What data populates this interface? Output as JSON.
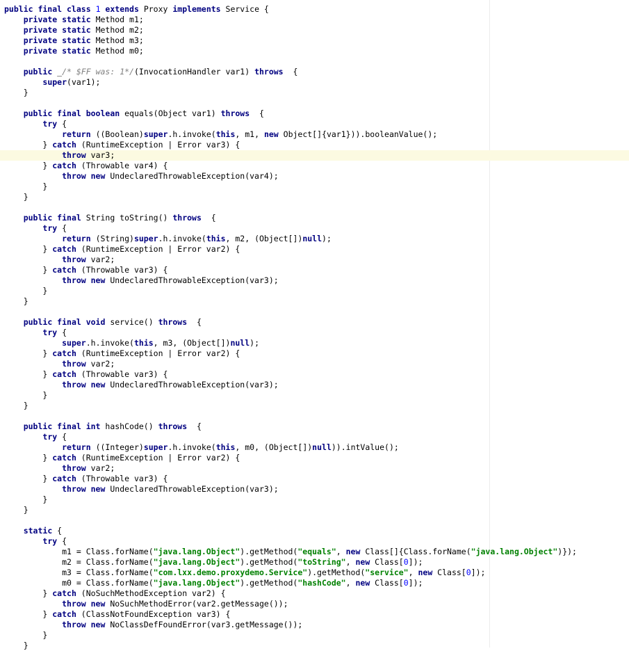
{
  "editor": {
    "highlighted_line": 14,
    "lines": [
      [
        [
          "kw",
          "public final class "
        ],
        [
          "num",
          "1"
        ],
        [
          "kw",
          " extends "
        ],
        [
          "plain",
          "Proxy "
        ],
        [
          "kw",
          "implements "
        ],
        [
          "plain",
          "Service {"
        ]
      ],
      [
        [
          "plain",
          "    "
        ],
        [
          "kw",
          "private static "
        ],
        [
          "plain",
          "Method m1;"
        ]
      ],
      [
        [
          "plain",
          "    "
        ],
        [
          "kw",
          "private static "
        ],
        [
          "plain",
          "Method m2;"
        ]
      ],
      [
        [
          "plain",
          "    "
        ],
        [
          "kw",
          "private static "
        ],
        [
          "plain",
          "Method m3;"
        ]
      ],
      [
        [
          "plain",
          "    "
        ],
        [
          "kw",
          "private static "
        ],
        [
          "plain",
          "Method m0;"
        ]
      ],
      [],
      [
        [
          "plain",
          "    "
        ],
        [
          "kw",
          "public "
        ],
        [
          "plain",
          "_"
        ],
        [
          "cmt",
          "/* $FF was: 1*/"
        ],
        [
          "plain",
          "(InvocationHandler var1) "
        ],
        [
          "kw",
          "throws"
        ],
        [
          "plain",
          "  {"
        ]
      ],
      [
        [
          "plain",
          "        "
        ],
        [
          "kw",
          "super"
        ],
        [
          "plain",
          "(var1);"
        ]
      ],
      [
        [
          "plain",
          "    }"
        ]
      ],
      [],
      [
        [
          "plain",
          "    "
        ],
        [
          "kw",
          "public final boolean "
        ],
        [
          "plain",
          "equals(Object var1) "
        ],
        [
          "kw",
          "throws"
        ],
        [
          "plain",
          "  {"
        ]
      ],
      [
        [
          "plain",
          "        "
        ],
        [
          "kw",
          "try "
        ],
        [
          "plain",
          "{"
        ]
      ],
      [
        [
          "plain",
          "            "
        ],
        [
          "kw",
          "return "
        ],
        [
          "plain",
          "((Boolean)"
        ],
        [
          "kw",
          "super"
        ],
        [
          "plain",
          ".h.invoke("
        ],
        [
          "kw",
          "this"
        ],
        [
          "plain",
          ", m1, "
        ],
        [
          "kw",
          "new "
        ],
        [
          "plain",
          "Object[]{var1})).booleanValue();"
        ]
      ],
      [
        [
          "plain",
          "        } "
        ],
        [
          "kw",
          "catch "
        ],
        [
          "plain",
          "(RuntimeException | Error var3) {"
        ]
      ],
      [
        [
          "plain",
          "            "
        ],
        [
          "kw",
          "throw "
        ],
        [
          "plain",
          "var3;"
        ]
      ],
      [
        [
          "plain",
          "        } "
        ],
        [
          "kw",
          "catch "
        ],
        [
          "plain",
          "(Throwable var4) {"
        ]
      ],
      [
        [
          "plain",
          "            "
        ],
        [
          "kw",
          "throw new "
        ],
        [
          "plain",
          "UndeclaredThrowableException(var4);"
        ]
      ],
      [
        [
          "plain",
          "        }"
        ]
      ],
      [
        [
          "plain",
          "    }"
        ]
      ],
      [],
      [
        [
          "plain",
          "    "
        ],
        [
          "kw",
          "public final "
        ],
        [
          "plain",
          "String toString() "
        ],
        [
          "kw",
          "throws"
        ],
        [
          "plain",
          "  {"
        ]
      ],
      [
        [
          "plain",
          "        "
        ],
        [
          "kw",
          "try "
        ],
        [
          "plain",
          "{"
        ]
      ],
      [
        [
          "plain",
          "            "
        ],
        [
          "kw",
          "return "
        ],
        [
          "plain",
          "(String)"
        ],
        [
          "kw",
          "super"
        ],
        [
          "plain",
          ".h.invoke("
        ],
        [
          "kw",
          "this"
        ],
        [
          "plain",
          ", m2, (Object[])"
        ],
        [
          "kw",
          "null"
        ],
        [
          "plain",
          ");"
        ]
      ],
      [
        [
          "plain",
          "        } "
        ],
        [
          "kw",
          "catch "
        ],
        [
          "plain",
          "(RuntimeException | Error var2) {"
        ]
      ],
      [
        [
          "plain",
          "            "
        ],
        [
          "kw",
          "throw "
        ],
        [
          "plain",
          "var2;"
        ]
      ],
      [
        [
          "plain",
          "        } "
        ],
        [
          "kw",
          "catch "
        ],
        [
          "plain",
          "(Throwable var3) {"
        ]
      ],
      [
        [
          "plain",
          "            "
        ],
        [
          "kw",
          "throw new "
        ],
        [
          "plain",
          "UndeclaredThrowableException(var3);"
        ]
      ],
      [
        [
          "plain",
          "        }"
        ]
      ],
      [
        [
          "plain",
          "    }"
        ]
      ],
      [],
      [
        [
          "plain",
          "    "
        ],
        [
          "kw",
          "public final void "
        ],
        [
          "plain",
          "service() "
        ],
        [
          "kw",
          "throws"
        ],
        [
          "plain",
          "  {"
        ]
      ],
      [
        [
          "plain",
          "        "
        ],
        [
          "kw",
          "try "
        ],
        [
          "plain",
          "{"
        ]
      ],
      [
        [
          "plain",
          "            "
        ],
        [
          "kw",
          "super"
        ],
        [
          "plain",
          ".h.invoke("
        ],
        [
          "kw",
          "this"
        ],
        [
          "plain",
          ", m3, (Object[])"
        ],
        [
          "kw",
          "null"
        ],
        [
          "plain",
          ");"
        ]
      ],
      [
        [
          "plain",
          "        } "
        ],
        [
          "kw",
          "catch "
        ],
        [
          "plain",
          "(RuntimeException | Error var2) {"
        ]
      ],
      [
        [
          "plain",
          "            "
        ],
        [
          "kw",
          "throw "
        ],
        [
          "plain",
          "var2;"
        ]
      ],
      [
        [
          "plain",
          "        } "
        ],
        [
          "kw",
          "catch "
        ],
        [
          "plain",
          "(Throwable var3) {"
        ]
      ],
      [
        [
          "plain",
          "            "
        ],
        [
          "kw",
          "throw new "
        ],
        [
          "plain",
          "UndeclaredThrowableException(var3);"
        ]
      ],
      [
        [
          "plain",
          "        }"
        ]
      ],
      [
        [
          "plain",
          "    }"
        ]
      ],
      [],
      [
        [
          "plain",
          "    "
        ],
        [
          "kw",
          "public final int "
        ],
        [
          "plain",
          "hashCode() "
        ],
        [
          "kw",
          "throws"
        ],
        [
          "plain",
          "  {"
        ]
      ],
      [
        [
          "plain",
          "        "
        ],
        [
          "kw",
          "try "
        ],
        [
          "plain",
          "{"
        ]
      ],
      [
        [
          "plain",
          "            "
        ],
        [
          "kw",
          "return "
        ],
        [
          "plain",
          "((Integer)"
        ],
        [
          "kw",
          "super"
        ],
        [
          "plain",
          ".h.invoke("
        ],
        [
          "kw",
          "this"
        ],
        [
          "plain",
          ", m0, (Object[])"
        ],
        [
          "kw",
          "null"
        ],
        [
          "plain",
          ")).intValue();"
        ]
      ],
      [
        [
          "plain",
          "        } "
        ],
        [
          "kw",
          "catch "
        ],
        [
          "plain",
          "(RuntimeException | Error var2) {"
        ]
      ],
      [
        [
          "plain",
          "            "
        ],
        [
          "kw",
          "throw "
        ],
        [
          "plain",
          "var2;"
        ]
      ],
      [
        [
          "plain",
          "        } "
        ],
        [
          "kw",
          "catch "
        ],
        [
          "plain",
          "(Throwable var3) {"
        ]
      ],
      [
        [
          "plain",
          "            "
        ],
        [
          "kw",
          "throw new "
        ],
        [
          "plain",
          "UndeclaredThrowableException(var3);"
        ]
      ],
      [
        [
          "plain",
          "        }"
        ]
      ],
      [
        [
          "plain",
          "    }"
        ]
      ],
      [],
      [
        [
          "plain",
          "    "
        ],
        [
          "kw",
          "static "
        ],
        [
          "plain",
          "{"
        ]
      ],
      [
        [
          "plain",
          "        "
        ],
        [
          "kw",
          "try "
        ],
        [
          "plain",
          "{"
        ]
      ],
      [
        [
          "plain",
          "            m1 = Class.forName("
        ],
        [
          "str",
          "\"java.lang.Object\""
        ],
        [
          "plain",
          ").getMethod("
        ],
        [
          "str",
          "\"equals\""
        ],
        [
          "plain",
          ", "
        ],
        [
          "kw",
          "new "
        ],
        [
          "plain",
          "Class[]{Class.forName("
        ],
        [
          "str",
          "\"java.lang.Object\""
        ],
        [
          "plain",
          ")});"
        ]
      ],
      [
        [
          "plain",
          "            m2 = Class.forName("
        ],
        [
          "str",
          "\"java.lang.Object\""
        ],
        [
          "plain",
          ").getMethod("
        ],
        [
          "str",
          "\"toString\""
        ],
        [
          "plain",
          ", "
        ],
        [
          "kw",
          "new "
        ],
        [
          "plain",
          "Class["
        ],
        [
          "num",
          "0"
        ],
        [
          "plain",
          "]);"
        ]
      ],
      [
        [
          "plain",
          "            m3 = Class.forName("
        ],
        [
          "str",
          "\"com.lxx.demo.proxydemo.Service\""
        ],
        [
          "plain",
          ").getMethod("
        ],
        [
          "str",
          "\"service\""
        ],
        [
          "plain",
          ", "
        ],
        [
          "kw",
          "new "
        ],
        [
          "plain",
          "Class["
        ],
        [
          "num",
          "0"
        ],
        [
          "plain",
          "]);"
        ]
      ],
      [
        [
          "plain",
          "            m0 = Class.forName("
        ],
        [
          "str",
          "\"java.lang.Object\""
        ],
        [
          "plain",
          ").getMethod("
        ],
        [
          "str",
          "\"hashCode\""
        ],
        [
          "plain",
          ", "
        ],
        [
          "kw",
          "new "
        ],
        [
          "plain",
          "Class["
        ],
        [
          "num",
          "0"
        ],
        [
          "plain",
          "]);"
        ]
      ],
      [
        [
          "plain",
          "        } "
        ],
        [
          "kw",
          "catch "
        ],
        [
          "plain",
          "(NoSuchMethodException var2) {"
        ]
      ],
      [
        [
          "plain",
          "            "
        ],
        [
          "kw",
          "throw new "
        ],
        [
          "plain",
          "NoSuchMethodError(var2.getMessage());"
        ]
      ],
      [
        [
          "plain",
          "        } "
        ],
        [
          "kw",
          "catch "
        ],
        [
          "plain",
          "(ClassNotFoundException var3) {"
        ]
      ],
      [
        [
          "plain",
          "            "
        ],
        [
          "kw",
          "throw new "
        ],
        [
          "plain",
          "NoClassDefFoundError(var3.getMessage());"
        ]
      ],
      [
        [
          "plain",
          "        }"
        ]
      ],
      [
        [
          "plain",
          "    }"
        ]
      ]
    ]
  }
}
